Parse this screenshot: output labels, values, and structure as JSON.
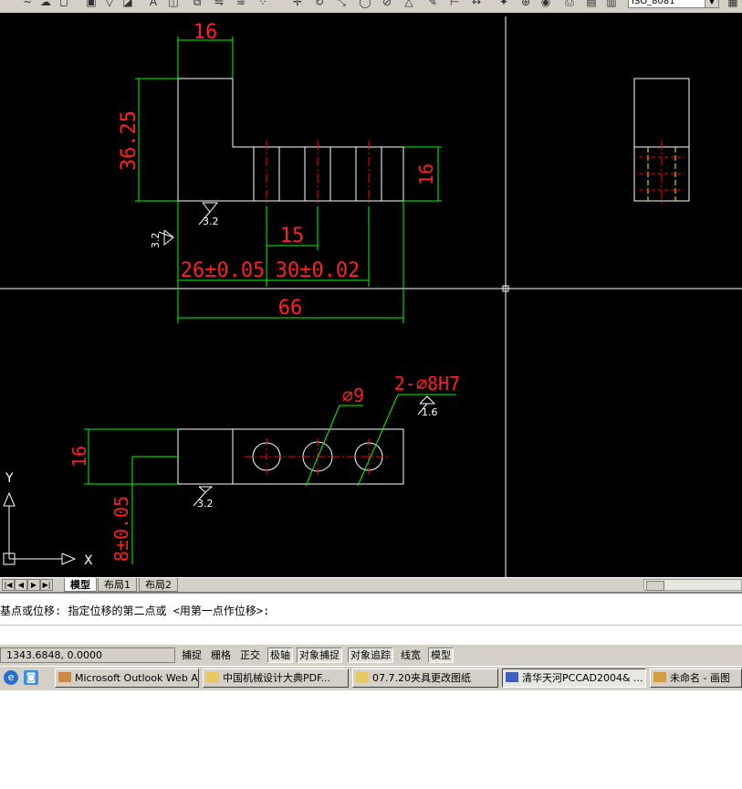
{
  "toolbar": {
    "layer_combo": "ISO_8081",
    "combo_arrow": "▼"
  },
  "drawing": {
    "dims": {
      "top_width": "16",
      "height": "36.25",
      "step_height": "16",
      "hole_pitch": "15",
      "dim_26": "26±0.05",
      "dim_30": "30±0.02",
      "overall": "66",
      "hole_dia": "⌀9",
      "hole_spec": "2-⌀8H7",
      "bottom_height": "16",
      "bottom_offset": "8±0.05"
    },
    "roughness": {
      "r1": "3.2",
      "r2": "3.2",
      "r3": "1.6",
      "r4": "3.2"
    },
    "ucs": {
      "x": "X",
      "y": "Y"
    }
  },
  "tabs": {
    "model": "模型",
    "layout1": "布局1",
    "layout2": "布局2"
  },
  "command": {
    "line": "基点或位移: 指定位移的第二点或 <用第一点作位移>:"
  },
  "status": {
    "coords": "1343.6848, 0.0000",
    "buttons": [
      "捕捉",
      "栅格",
      "正交",
      "极轴",
      "对象捕捉",
      "对象追踪",
      "线宽",
      "模型"
    ]
  },
  "taskbar": {
    "items": [
      {
        "label": "Microsoft Outlook Web A..."
      },
      {
        "label": "中国机械设计大典PDF..."
      },
      {
        "label": "07.7.20夹具更改图纸"
      },
      {
        "label": "清华天河PCCAD2004& ..."
      },
      {
        "label": "未命名 - 画图"
      }
    ]
  },
  "colors": {
    "canvas_bg": "#000000",
    "outline": "#ffffff",
    "dimension": "#00ff00",
    "dim_text": "#ff2020",
    "center_line": "#ff0000",
    "hidden_line": "#ffff00"
  }
}
